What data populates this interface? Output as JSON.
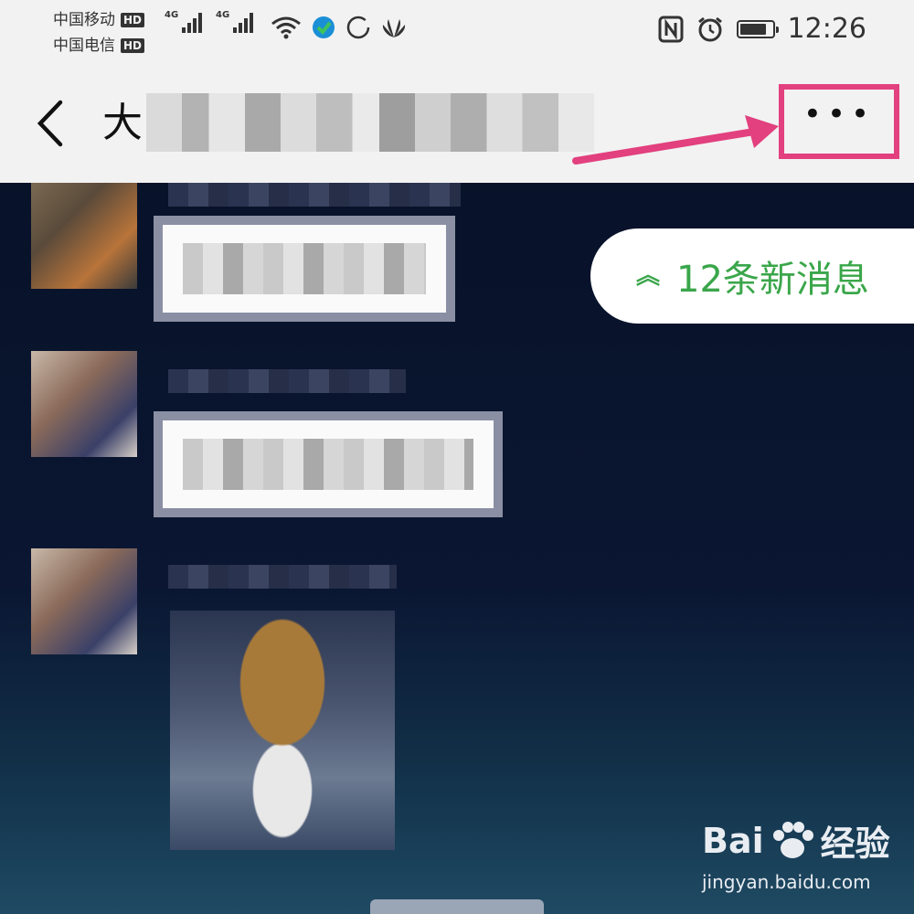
{
  "status_bar": {
    "carriers": [
      {
        "name": "中国移动",
        "badge": "HD",
        "network": "4G"
      },
      {
        "name": "中国电信",
        "badge": "HD",
        "network": "4G"
      }
    ],
    "time": "12:26",
    "battery_level": 0.85,
    "icons": [
      "nfc-icon",
      "alarm-icon",
      "wifi-icon",
      "app-icon",
      "circle-icon",
      "huawei-icon"
    ]
  },
  "header": {
    "title_prefix": "大"
  },
  "chat": {
    "new_messages_label": "12条新消息",
    "accent_color": "#3aa64a"
  },
  "annotation": {
    "highlight_color": "#e2407e"
  },
  "watermark": {
    "brand": "Bai",
    "brand_suffix": "经验",
    "url": "jingyan.baidu.com"
  }
}
